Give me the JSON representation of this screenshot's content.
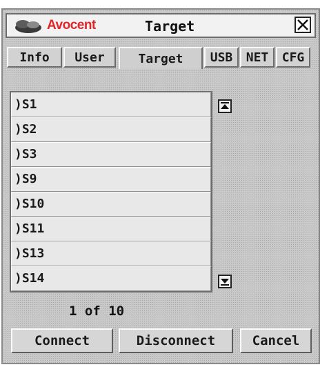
{
  "window": {
    "logo_text": "Avocent",
    "title": "Target",
    "close_icon": "close-icon"
  },
  "tabs": [
    {
      "label": "Info",
      "active": false
    },
    {
      "label": "User",
      "active": false
    },
    {
      "label": "Target",
      "active": true
    },
    {
      "label": "USB",
      "active": false
    },
    {
      "label": "NET",
      "active": false
    },
    {
      "label": "CFG",
      "active": false
    }
  ],
  "targets": [
    ")S1",
    ")S2",
    ")S3",
    ")S9",
    ")S10",
    ")S11",
    ")S13",
    ")S14"
  ],
  "scroll": {
    "up_icon": "scroll-to-top-icon",
    "down_icon": "scroll-to-bottom-icon"
  },
  "pagination": {
    "text": "1 of 10",
    "current": 1,
    "total": 10
  },
  "buttons": {
    "connect": "Connect",
    "disconnect": "Disconnect",
    "cancel": "Cancel"
  },
  "colors": {
    "brand": "#e0262b",
    "panel": "#c9c9c9",
    "row": "#e8e8e8"
  }
}
